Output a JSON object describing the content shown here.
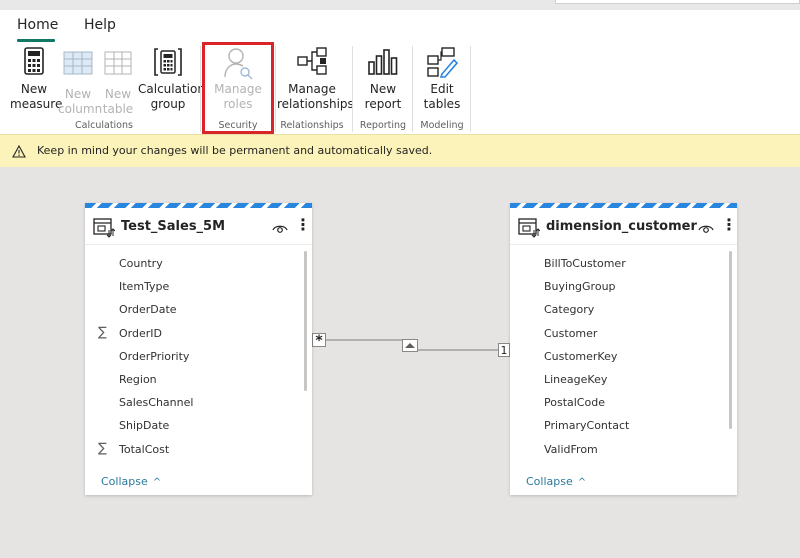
{
  "ribbon": {
    "tabs": [
      {
        "label": "Home",
        "active": true
      },
      {
        "label": "Help",
        "active": false
      }
    ],
    "commands": [
      {
        "id": "new-measure",
        "label_line1": "New",
        "label_line2": "measure",
        "icon": "calculator-icon",
        "enabled": true
      },
      {
        "id": "new-column",
        "label_line1": "New",
        "label_line2": "column",
        "icon": "table-column-icon",
        "enabled": false
      },
      {
        "id": "new-table",
        "label_line1": "New",
        "label_line2": "table",
        "icon": "table-icon",
        "enabled": false
      },
      {
        "id": "calculation-group",
        "label_line1": "Calculation",
        "label_line2": "group",
        "icon": "calculation-group-icon",
        "enabled": true
      },
      {
        "id": "manage-roles",
        "label_line1": "Manage",
        "label_line2": "roles",
        "icon": "person-key-icon",
        "enabled": false
      },
      {
        "id": "manage-relationships",
        "label_line1": "Manage",
        "label_line2": "relationships",
        "icon": "relationships-icon",
        "enabled": true
      },
      {
        "id": "new-report",
        "label_line1": "New",
        "label_line2": "report",
        "icon": "bar-chart-icon",
        "enabled": true
      },
      {
        "id": "edit-tables",
        "label_line1": "Edit",
        "label_line2": "tables",
        "icon": "edit-tables-icon",
        "enabled": true
      }
    ],
    "groups": {
      "calculations": "Calculations",
      "security": "Security",
      "relationships": "Relationships",
      "reporting": "Reporting",
      "modeling": "Modeling"
    }
  },
  "banner": {
    "icon": "warning-icon",
    "message": "Keep in mind your changes will be permanent and automatically saved."
  },
  "tables": {
    "left": {
      "name": "Test_Sales_5M",
      "fields": [
        {
          "name": "Country",
          "sigma": ""
        },
        {
          "name": "ItemType",
          "sigma": ""
        },
        {
          "name": "OrderDate",
          "sigma": ""
        },
        {
          "name": "OrderID",
          "sigma": "∑"
        },
        {
          "name": "OrderPriority",
          "sigma": ""
        },
        {
          "name": "Region",
          "sigma": ""
        },
        {
          "name": "SalesChannel",
          "sigma": ""
        },
        {
          "name": "ShipDate",
          "sigma": ""
        },
        {
          "name": "TotalCost",
          "sigma": "∑"
        }
      ],
      "collapse_label": "Collapse"
    },
    "right": {
      "name": "dimension_customer",
      "fields": [
        {
          "name": "BillToCustomer",
          "sigma": ""
        },
        {
          "name": "BuyingGroup",
          "sigma": ""
        },
        {
          "name": "Category",
          "sigma": ""
        },
        {
          "name": "Customer",
          "sigma": ""
        },
        {
          "name": "CustomerKey",
          "sigma": ""
        },
        {
          "name": "LineageKey",
          "sigma": ""
        },
        {
          "name": "PostalCode",
          "sigma": ""
        },
        {
          "name": "PrimaryContact",
          "sigma": ""
        },
        {
          "name": "ValidFrom",
          "sigma": ""
        }
      ],
      "collapse_label": "Collapse"
    }
  },
  "relationship": {
    "many_marker": "*",
    "one_marker": "1",
    "direction_icon": "caret-up-icon"
  },
  "colors": {
    "accent": "#117865",
    "highlight": "#d9242a",
    "banner_bg": "#fbf3b9",
    "table_header_stripe": "#2886de",
    "link": "#2b7a9a"
  }
}
